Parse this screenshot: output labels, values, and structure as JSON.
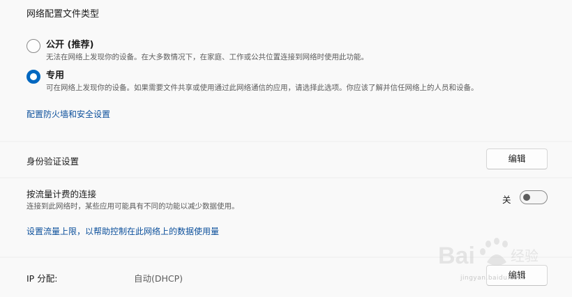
{
  "network_profile": {
    "title": "网络配置文件类型",
    "public": {
      "label": "公开 (推荐)",
      "description": "无法在网络上发现你的设备。在大多数情况下，在家庭、工作或公共位置连接到网络时使用此功能。",
      "selected": false
    },
    "private": {
      "label": "专用",
      "description": "可在网络上发现你的设备。如果需要文件共享或使用通过此网络通信的应用，请选择此选项。你应该了解并信任网络上的人员和设备。",
      "selected": true
    },
    "firewall_link": "配置防火墙和安全设置"
  },
  "authentication": {
    "label": "身份验证设置",
    "button": "编辑"
  },
  "metered": {
    "label": "按流量计费的连接",
    "description": "连接到此网络时，某些应用可能具有不同的功能以减少数据使用。",
    "toggle_state": "关",
    "enabled": false,
    "limit_link": "设置流量上限，以帮助控制在此网络上的数据使用量"
  },
  "ip": {
    "label": "IP 分配:",
    "value": "自动(DHCP)",
    "button": "编辑"
  },
  "watermark": {
    "brand": "Bai 经验",
    "url": "jingyan.baidu.com"
  },
  "colors": {
    "accent": "#0067c0",
    "link": "#0b4f9b",
    "background": "#f3f3f3",
    "card": "#f9f9f9"
  }
}
